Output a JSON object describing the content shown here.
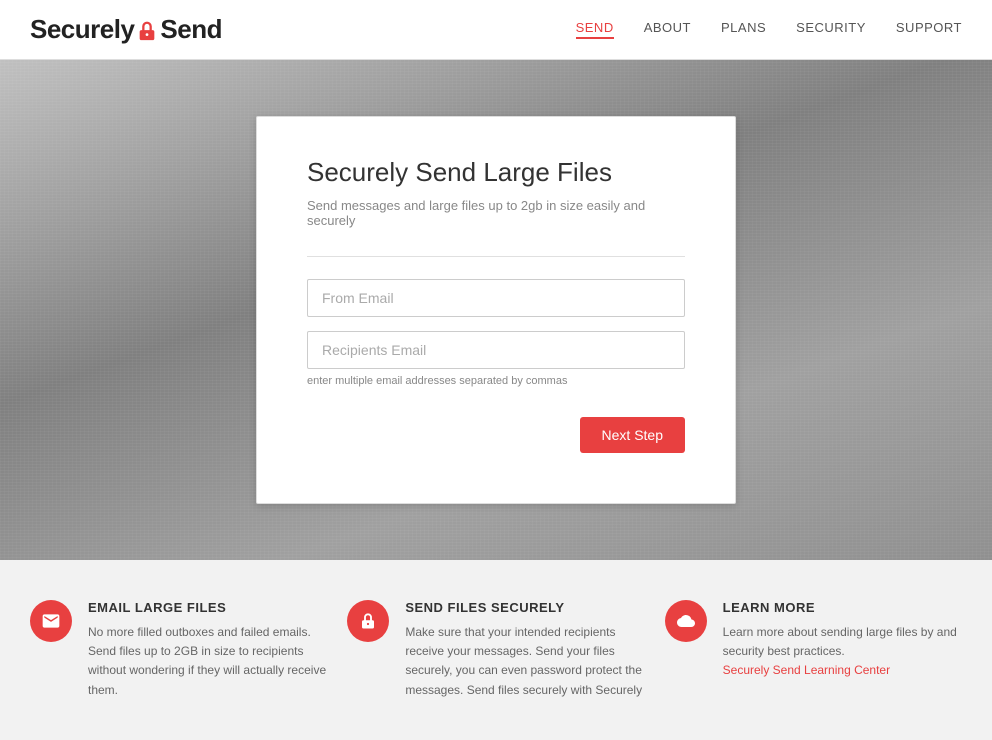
{
  "header": {
    "logo_text_before": "Securely ",
    "logo_text_after": "Send",
    "nav": [
      {
        "label": "SEND",
        "active": true
      },
      {
        "label": "ABOUT",
        "active": false
      },
      {
        "label": "PLANS",
        "active": false
      },
      {
        "label": "SECURITY",
        "active": false
      },
      {
        "label": "SUPPORT",
        "active": false
      }
    ]
  },
  "hero": {
    "card": {
      "title": "Securely Send Large Files",
      "subtitle": "Send messages and large files up to 2gb in size easily and securely",
      "from_email_placeholder": "From Email",
      "recipients_placeholder": "Recipients Email",
      "recipients_hint": "enter multiple email addresses separated by commas",
      "next_button": "Next Step"
    }
  },
  "features": [
    {
      "icon": "email",
      "title": "EMAIL LARGE FILES",
      "body": "No more filled outboxes and failed emails. Send files up to 2GB in size to recipients without wondering if they will actually receive them.",
      "link": null
    },
    {
      "icon": "lock",
      "title": "SEND FILES SECURELY",
      "body": "Make sure that your intended recipients receive your messages. Send your files securely, you can even password protect the messages. Send files securely with Securely",
      "link": null
    },
    {
      "icon": "cloud",
      "title": "LEARN MORE",
      "body": "Learn more about sending large files by and security best practices.",
      "link_text": "Securely Send Learning Center",
      "link_href": "#"
    }
  ]
}
